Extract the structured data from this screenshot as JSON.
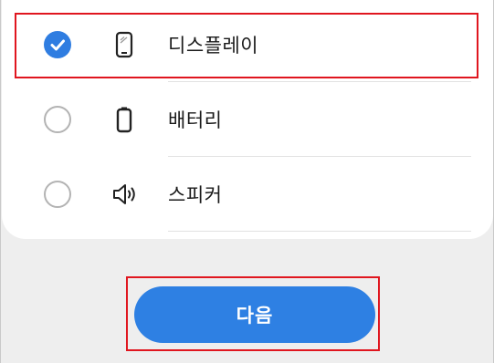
{
  "options": [
    {
      "label": "디스플레이",
      "icon": "phone-display-icon",
      "checked": true
    },
    {
      "label": "배터리",
      "icon": "battery-icon",
      "checked": false
    },
    {
      "label": "스피커",
      "icon": "speaker-icon",
      "checked": false
    }
  ],
  "next_button": {
    "label": "다음"
  },
  "colors": {
    "accent": "#2e80e3",
    "highlight": "#e0161f"
  }
}
